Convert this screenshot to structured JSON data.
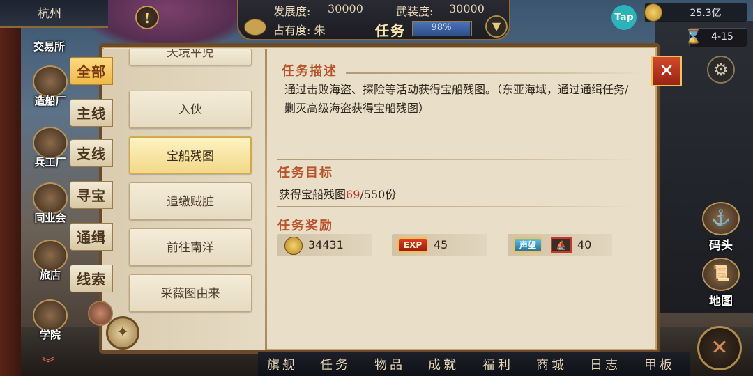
{
  "top": {
    "city": "杭州",
    "development_label": "发展度:",
    "development_value": "30000",
    "military_label": "武装度:",
    "military_value": "30000",
    "occupancy_label": "占有度: 朱",
    "panel_title": "任务",
    "progress_text": "98%",
    "progress_fraction": 0.98,
    "tap_label": "Tap",
    "gold": "25.3亿",
    "date": "4-15"
  },
  "left_buildings": [
    {
      "label": "交易所"
    },
    {
      "label": "造船厂"
    },
    {
      "label": "兵工厂"
    },
    {
      "label": "同业会"
    },
    {
      "label": "旅店"
    },
    {
      "label": "学院"
    }
  ],
  "tabs": [
    {
      "label": "全部",
      "selected": true
    },
    {
      "label": "主线",
      "selected": false
    },
    {
      "label": "支线",
      "selected": false
    },
    {
      "label": "寻宝",
      "selected": false
    },
    {
      "label": "通缉",
      "selected": false
    },
    {
      "label": "线索",
      "selected": false
    }
  ],
  "quests": [
    {
      "label": "天境平児"
    },
    {
      "label": "入伙"
    },
    {
      "label": "宝船残图",
      "selected": true
    },
    {
      "label": "追缴贼脏"
    },
    {
      "label": "前往南洋"
    },
    {
      "label": "采薇图由来"
    }
  ],
  "detail": {
    "desc_title": "任务描述",
    "desc_text": "通过击败海盗、探险等活动获得宝船残图。（东亚海域，通过通缉任务/剿灭高级海盗获得宝船残图）",
    "goal_title": "任务目标",
    "goal_prefix": "获得宝船残图",
    "goal_current": "69",
    "goal_suffix": "/550份",
    "reward_title": "任务奖励",
    "rewards": [
      {
        "icon": "gold-coin-icon",
        "value": "34431"
      },
      {
        "icon": "exp-icon",
        "badge": "EXP",
        "value": "45"
      },
      {
        "icon": "fame-icon",
        "badge": "声望",
        "value": "40"
      }
    ]
  },
  "right_buttons": [
    {
      "label": "码头"
    },
    {
      "label": "地图"
    }
  ],
  "bottom_nav": [
    "旗舰",
    "任务",
    "物品",
    "成就",
    "福利",
    "商城",
    "日志",
    "甲板"
  ],
  "colors": {
    "accent_red": "#b8532b",
    "goal_highlight": "#d12a1e",
    "selected_gold": "#f0b946"
  }
}
